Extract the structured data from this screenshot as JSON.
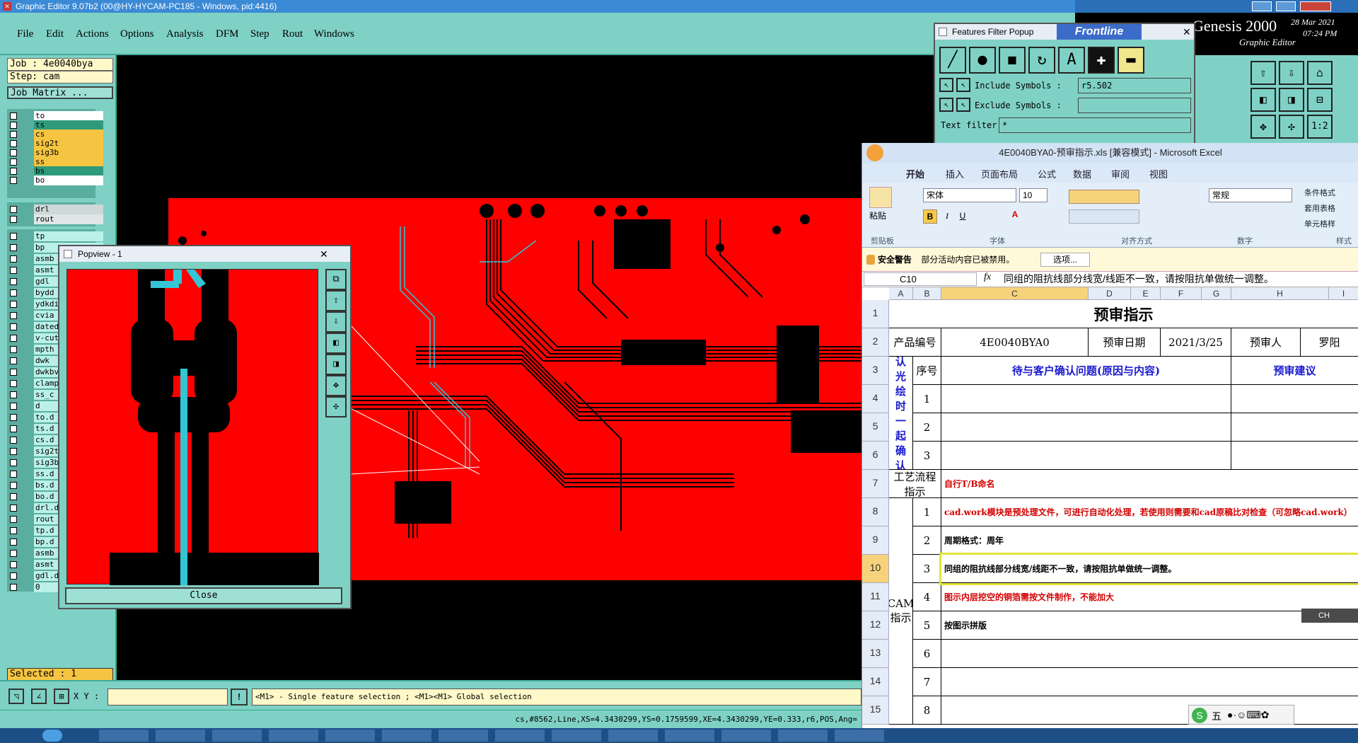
{
  "app": {
    "window_title": "Graphic Editor 9.07b2 (00@HY-HYCAM-PC185 - Windows, pid:4416)",
    "menus": [
      "File",
      "Edit",
      "Actions",
      "Options",
      "Analysis",
      "DFM",
      "Step",
      "Rout",
      "Windows"
    ],
    "genesis_title": "Genesis 2000",
    "genesis_subtitle": "Graphic Editor",
    "date": "28 Mar 2021",
    "time": "07:24 PM"
  },
  "job": {
    "job_label": "Job : 4e0040bya",
    "step_label": "Step: cam",
    "matrix_button": "Job Matrix ...",
    "selected": "Selected : 1"
  },
  "layers_top": [
    {
      "name": "to",
      "color": "#ffffff"
    },
    {
      "name": "ts",
      "color": "#2e9a7a"
    },
    {
      "name": "cs",
      "color": "#f5c542"
    },
    {
      "name": "sig2t",
      "color": "#f5c542"
    },
    {
      "name": "sig3b",
      "color": "#f5c542"
    },
    {
      "name": "ss",
      "color": "#f5c542"
    },
    {
      "name": "bs",
      "color": "#2e9a7a"
    },
    {
      "name": "bo",
      "color": "#ffffff"
    }
  ],
  "layers_drill": [
    {
      "name": "drl",
      "color": "#cfd8d8"
    },
    {
      "name": "rout",
      "color": "#dfe6e6"
    }
  ],
  "layers_misc": [
    "tp",
    "bp",
    "asmb",
    "asmt",
    "gdl",
    "bydd",
    "ydkdi",
    "cvia",
    "dated",
    "v-cut",
    "mpth",
    "dwk",
    "dwkbv",
    "clamp",
    "ss_c",
    "d",
    "to.d",
    "ts.d",
    "cs.d",
    "sig2t",
    "sig3b",
    "ss.d",
    "bs.d",
    "bo.d",
    "drl.d",
    "rout",
    "tp.d",
    "bp.d",
    "asmb",
    "asmt",
    "gdl.d",
    "0"
  ],
  "popview": {
    "title": "Popview - 1",
    "close_label": "Close"
  },
  "features_filter": {
    "title": "Features Filter Popup",
    "include_label": "Include Symbols :",
    "include_value": "r5.502",
    "exclude_label": "Exclude Symbols :",
    "exclude_value": "",
    "text_filter_label": "Text filter",
    "text_filter_value": "*"
  },
  "command": {
    "xy_label": "X Y :",
    "hint": "<M1> - Single feature selection ; <M1><M1> Global selection",
    "status": "cs,#8562,Line,XS=4.3430299,YS=0.1759599,XE=4.3430299,YE=0.333,r6,POS,Ang="
  },
  "excel": {
    "title": "4E0040BYA0-预审指示.xls  [兼容模式] - Microsoft Excel",
    "tabs": [
      "开始",
      "插入",
      "页面布局",
      "公式",
      "数据",
      "审阅",
      "视图"
    ],
    "font_name": "宋体",
    "font_size": "10",
    "number_format": "常规",
    "group_labels": [
      "剪贴板",
      "字体",
      "对齐方式",
      "数字",
      "样式"
    ],
    "style_items": [
      "条件格式",
      "套用表格",
      "单元格样"
    ],
    "paste_label": "粘贴",
    "security_label": "安全警告",
    "security_text": "部分活动内容已被禁用。",
    "options_button": "选项...",
    "cell_ref": "C10",
    "formula": "同组的阻抗线部分线宽/线距不一致，请按阻抗单做统一调整。",
    "columns": [
      "A",
      "B",
      "C",
      "D",
      "E",
      "F",
      "G",
      "H",
      "I"
    ],
    "rows": [
      "1",
      "2",
      "3",
      "4",
      "5",
      "6",
      "7",
      "8",
      "9",
      "10",
      "11",
      "12",
      "13",
      "14",
      "15"
    ],
    "sheet": {
      "heading": "预审指示",
      "product_no_label": "产品编号",
      "product_no": "4E0040BYA0",
      "review_date_label": "预审日期",
      "review_date": "2021/3/25",
      "reviewer_label": "预审人",
      "reviewer": "罗阳",
      "seq_label": "序号",
      "pending_header": "待与客户确认问题(原因与内容)",
      "suggest_header": "预审建议",
      "pending_label": "待确认光绘时一起确认问题",
      "pending_nums": [
        "1",
        "2",
        "3"
      ],
      "process_label": "工艺流程指示",
      "process_text": "自行T/B命名",
      "cam_label": "CAM指示",
      "cam_items": [
        {
          "num": "1",
          "text": "cad.work模块是预处理文件，可进行自动化处理，若使用则需要和cad原稿比对检查（可忽略cad.work）",
          "color": "#d40000"
        },
        {
          "num": "2",
          "text": "周期格式：周年",
          "color": "#000000"
        },
        {
          "num": "3",
          "text": "同组的阻抗线部分线宽/线距不一致，请按阻抗单做统一调整。",
          "color": "#000000"
        },
        {
          "num": "4",
          "text": "图示内层挖空的铜箔需按文件制作，不能加大",
          "color": "#d40000"
        },
        {
          "num": "5",
          "text": "按图示拼版",
          "color": "#000000"
        },
        {
          "num": "6",
          "text": "",
          "color": "#000000"
        },
        {
          "num": "7",
          "text": "",
          "color": "#000000"
        },
        {
          "num": "8",
          "text": "",
          "color": "#000000"
        }
      ]
    }
  },
  "ime": {
    "label": "五",
    "lang": "CH"
  }
}
